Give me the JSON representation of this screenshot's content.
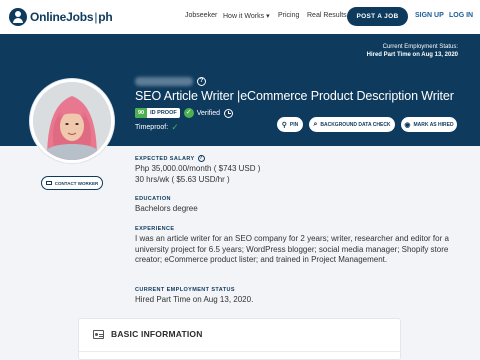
{
  "brand": {
    "name": "OnlineJobs",
    "separator": "|",
    "suffix": "ph"
  },
  "nav": {
    "links": [
      "Jobseeker",
      "How it Works",
      "Pricing",
      "Real Results"
    ],
    "how_it_works_caret": "▾",
    "post_job": "POST A JOB",
    "sign_up": "SIGN UP",
    "log_in": "LOG IN"
  },
  "header": {
    "status_label": "Current Employment Status:",
    "status_value": "Hired Part Time on Aug 13, 2020",
    "help_glyph": "?",
    "job_title": "SEO Article Writer |eCommerce Product Description Writer",
    "id_score": "90",
    "id_proof": "ID PROOF",
    "verified": "Verified",
    "timeproof": "Timeproof:",
    "check_glyph": "✓"
  },
  "actions": {
    "pin": "PIN",
    "background_check": "BACKGROUND DATA CHECK",
    "mark_hired": "MARK AS HIRED",
    "contact": "CONTACT WORKER"
  },
  "details": {
    "salary_label": "EXPECTED SALARY",
    "salary_monthly": "Php 35,000.00/month ( $743 USD )",
    "salary_hourly": "30 hrs/wk ( $5.63 USD/hr )",
    "education_label": "EDUCATION",
    "education_value": "Bachelors degree",
    "experience_label": "EXPERIENCE",
    "experience_value": "I was an article writer for an SEO company for 2 years; writer, researcher and editor for a university project for 6.5 years; WordPress blogger; social media manager; Shopify store creator; eCommerce product lister; and trained in Project Management.",
    "employment_label": "CURRENT EMPLOYMENT STATUS",
    "employment_value": "Hired Part Time on Aug 13, 2020."
  },
  "basic_info": {
    "title": "BASIC INFORMATION"
  },
  "colors": {
    "navy": "#0e3a5d",
    "verified_green": "#4caf50",
    "link_blue": "#1a5c96",
    "page_bg": "#f2f4f7",
    "hijab_pink": "#e8788f"
  },
  "icons": [
    "logo-icon",
    "help-icon",
    "check-icon",
    "clock-icon",
    "pin-icon",
    "search-icon",
    "eye-icon",
    "mail-icon",
    "id-card-icon"
  ]
}
